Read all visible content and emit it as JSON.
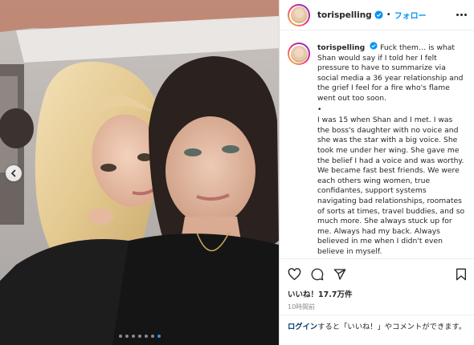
{
  "post": {
    "username": "torispelling",
    "separator": "•",
    "follow_label": "フォロー",
    "caption_intro": "Fuck them… is what Shan would say if I told her I felt pressure to have to summarize via social media a 36 year relationship and the grief I feel for a fire who's flame went out too soon.",
    "caption_bullet": "•",
    "caption_body": "I was 15 when Shan and I met. I was the boss's daughter with no voice and she was the star with a big voice. She took me under her wing. She gave me the belief I had a voice and was worthy. We became fast best friends. We were each others wing women, true confidantes, support systems navigating bad relationships, roomates of sorts at times, travel buddies, and so much more. She always stuck up for me. Always had my back. Always believed in me when I didn't even believe in myself.",
    "likes": "いいね！17.7万件",
    "time_ago": "10時間前",
    "login_link": "ログイン",
    "login_rest": "すると「いいね！」やコメントができます。"
  },
  "carousel": {
    "total": 7,
    "active_index": 6
  },
  "icons": {
    "prev": "chevron-left-icon",
    "verified": "verified-badge-icon",
    "more": "more-options-icon",
    "like": "heart-icon",
    "comment": "comment-icon",
    "share": "share-icon",
    "save": "bookmark-icon"
  },
  "colors": {
    "verified": "#0095f6",
    "follow": "#0095f6",
    "active_dot": "#2f8ef6"
  }
}
